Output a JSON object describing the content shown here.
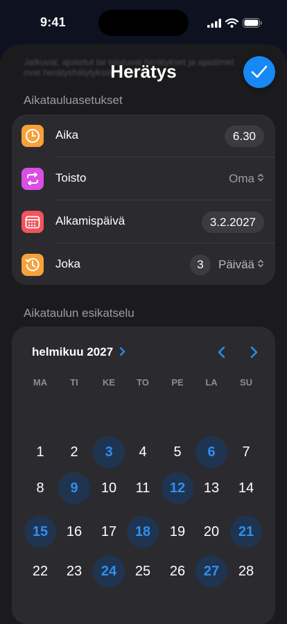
{
  "status_bar": {
    "time": "9:41"
  },
  "sheet": {
    "background_text": "Jatkuvat, ajoitetut tai toistuvat herätykset ja ajastimet ovat herätyshälytyksiä",
    "title": "Herätys",
    "done_icon": "checkmark-icon"
  },
  "schedule_settings": {
    "header": "Aikatauluasetukset",
    "rows": [
      {
        "label": "Aika",
        "value": "6.30",
        "icon": "clock-icon",
        "icon_color": "#f7a13b"
      },
      {
        "label": "Toisto",
        "value": "Oma",
        "icon": "repeat-icon",
        "icon_color": "#d94fe3"
      },
      {
        "label": "Alkamispäivä",
        "value": "3.2.2027",
        "icon": "calendar-icon",
        "icon_color": "#f2545b"
      },
      {
        "label": "Joka",
        "count": "3",
        "value": "Päivää",
        "icon": "history-icon",
        "icon_color": "#f7a13b"
      }
    ]
  },
  "preview": {
    "header": "Aikataulun esikatselu",
    "month": "helmikuu 2027",
    "weekdays": [
      "MA",
      "TI",
      "KE",
      "TO",
      "PE",
      "LA",
      "SU"
    ],
    "weeks": [
      [
        "1",
        "2",
        "3",
        "4",
        "5",
        "6",
        "7"
      ],
      [
        "8",
        "9",
        "10",
        "11",
        "12",
        "13",
        "14"
      ],
      [
        "15",
        "16",
        "17",
        "18",
        "19",
        "20",
        "21"
      ],
      [
        "22",
        "23",
        "24",
        "25",
        "26",
        "27",
        "28"
      ]
    ],
    "highlighted_days": [
      "3",
      "6",
      "9",
      "12",
      "15",
      "18",
      "21",
      "24",
      "27"
    ]
  },
  "colors": {
    "accent": "#1689f5",
    "selected_day_bg": "#1e3450",
    "selected_day_text": "#2f8ff0",
    "card": "#2b2b2f"
  }
}
